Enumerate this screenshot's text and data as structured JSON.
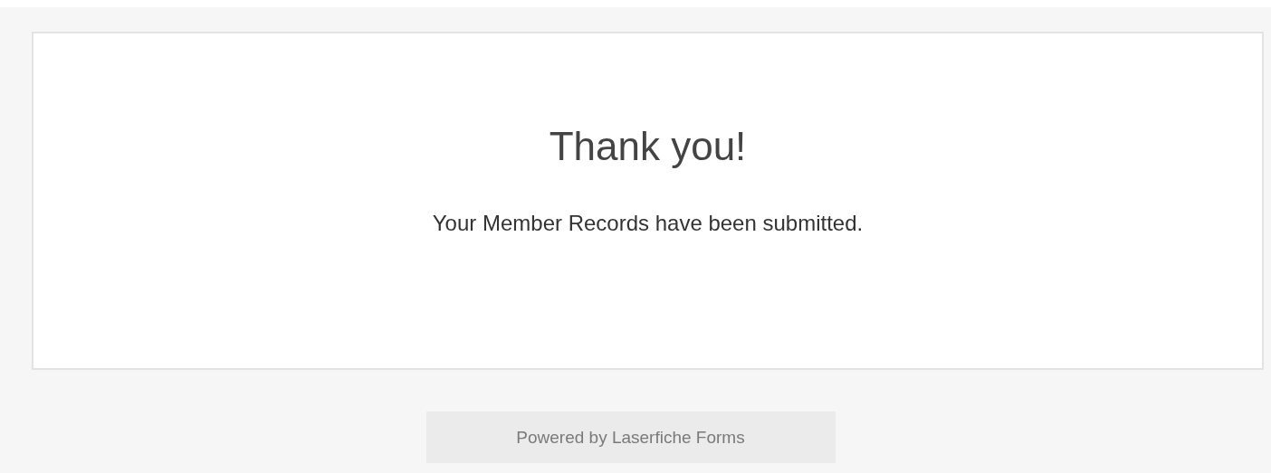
{
  "confirmation": {
    "title": "Thank you!",
    "message": "Your Member Records have been submitted."
  },
  "footer": {
    "text": "Powered by Laserfiche Forms"
  }
}
